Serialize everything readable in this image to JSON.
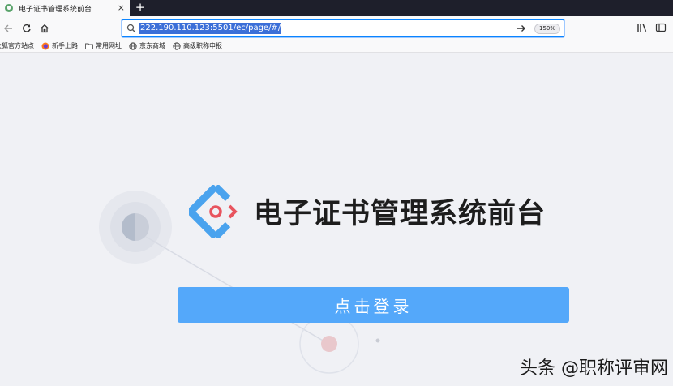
{
  "browser": {
    "tab": {
      "title": "电子证书管理系统前台",
      "close_glyph": "×",
      "favicon": "page-favicon"
    },
    "new_tab_glyph": "+",
    "nav": {
      "back_icon": "back-arrow-icon",
      "reload_icon": "reload-icon",
      "home_icon": "home-icon"
    },
    "url": {
      "value": "222.190.110.123:5501/ec/page/#/",
      "zoom": "150%"
    },
    "bookmarks": [
      {
        "label": "火狐官方站点",
        "icon": "firefox-icon"
      },
      {
        "label": "新手上路",
        "icon": "firefox-icon"
      },
      {
        "label": "常用网址",
        "icon": "folder-icon"
      },
      {
        "label": "京东商城",
        "icon": "globe-icon"
      },
      {
        "label": "高级职称申报",
        "icon": "globe-icon"
      }
    ]
  },
  "page": {
    "title": "电子证书管理系统前台",
    "login_button": "点击登录"
  },
  "watermark": "头条 @职称评审网",
  "colors": {
    "accent": "#54a8fa",
    "logo_blue": "#4aa3ee",
    "logo_red": "#e8545e"
  }
}
